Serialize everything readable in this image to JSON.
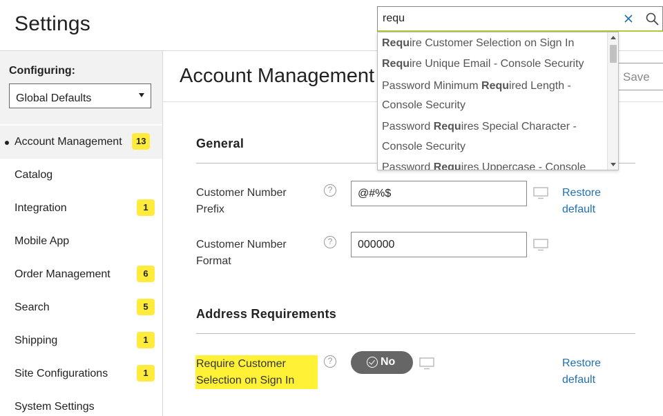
{
  "header": {
    "title": "Settings"
  },
  "search": {
    "value": "requ",
    "suggestions": [
      {
        "parts": [
          {
            "text": "Requ",
            "bold": true
          },
          {
            "text": "ire Customer Selection on Sign In",
            "bold": false
          }
        ]
      },
      {
        "parts": [
          {
            "text": "Requ",
            "bold": true
          },
          {
            "text": "ire Unique Email - Console Security",
            "bold": false
          }
        ]
      },
      {
        "parts": [
          {
            "text": "Password Minimum ",
            "bold": false
          },
          {
            "text": "Requ",
            "bold": true
          },
          {
            "text": "ired Length -",
            "bold": false
          }
        ]
      },
      {
        "parts": [
          {
            "text": "Console Security",
            "bold": false
          }
        ]
      },
      {
        "parts": [
          {
            "text": "Password ",
            "bold": false
          },
          {
            "text": "Requ",
            "bold": true
          },
          {
            "text": "ires Special Character -",
            "bold": false
          }
        ]
      },
      {
        "parts": [
          {
            "text": "Console Security",
            "bold": false
          }
        ]
      },
      {
        "parts": [
          {
            "text": "Password ",
            "bold": false
          },
          {
            "text": "Requ",
            "bold": true
          },
          {
            "text": "ires Uppercase - Console",
            "bold": false
          }
        ]
      }
    ]
  },
  "sidebar": {
    "configuring_label": "Configuring:",
    "scope_value": "Global Defaults",
    "items": [
      {
        "label": "Account Management",
        "badge": "13",
        "active": true
      },
      {
        "label": "Catalog",
        "badge": "",
        "active": false
      },
      {
        "label": "Integration",
        "badge": "1",
        "active": false
      },
      {
        "label": "Mobile App",
        "badge": "",
        "active": false
      },
      {
        "label": "Order Management",
        "badge": "6",
        "active": false
      },
      {
        "label": "Search",
        "badge": "5",
        "active": false
      },
      {
        "label": "Shipping",
        "badge": "1",
        "active": false
      },
      {
        "label": "Site Configurations",
        "badge": "1",
        "active": false
      },
      {
        "label": "System Settings",
        "badge": "",
        "active": false
      }
    ]
  },
  "main": {
    "title": "Account Management",
    "save_label": "Save",
    "sections": {
      "general": {
        "title": "General",
        "customer_number_prefix": {
          "label_line1": "Customer Number",
          "label_line2": "Prefix",
          "value": "@#%$",
          "restore_line1": "Restore",
          "restore_line2": "default"
        },
        "customer_number_format": {
          "label_line1": "Customer Number",
          "label_line2": "Format",
          "value": "000000"
        }
      },
      "address": {
        "title": "Address Requirements",
        "require_selection": {
          "label_line1": "Require Customer",
          "label_line2": "Selection on Sign In",
          "toggle_label": "No",
          "restore_line1": "Restore",
          "restore_line2": "default"
        }
      }
    }
  },
  "colors": {
    "badge": "#ffeb3b",
    "highlight": "#fff236",
    "link": "#1f6fb5",
    "toggle": "#666666",
    "search_underline": "#b4c93a"
  },
  "icons": {
    "help": "?",
    "clear": "close-icon",
    "search": "search-icon",
    "monitor": "monitor-icon"
  }
}
